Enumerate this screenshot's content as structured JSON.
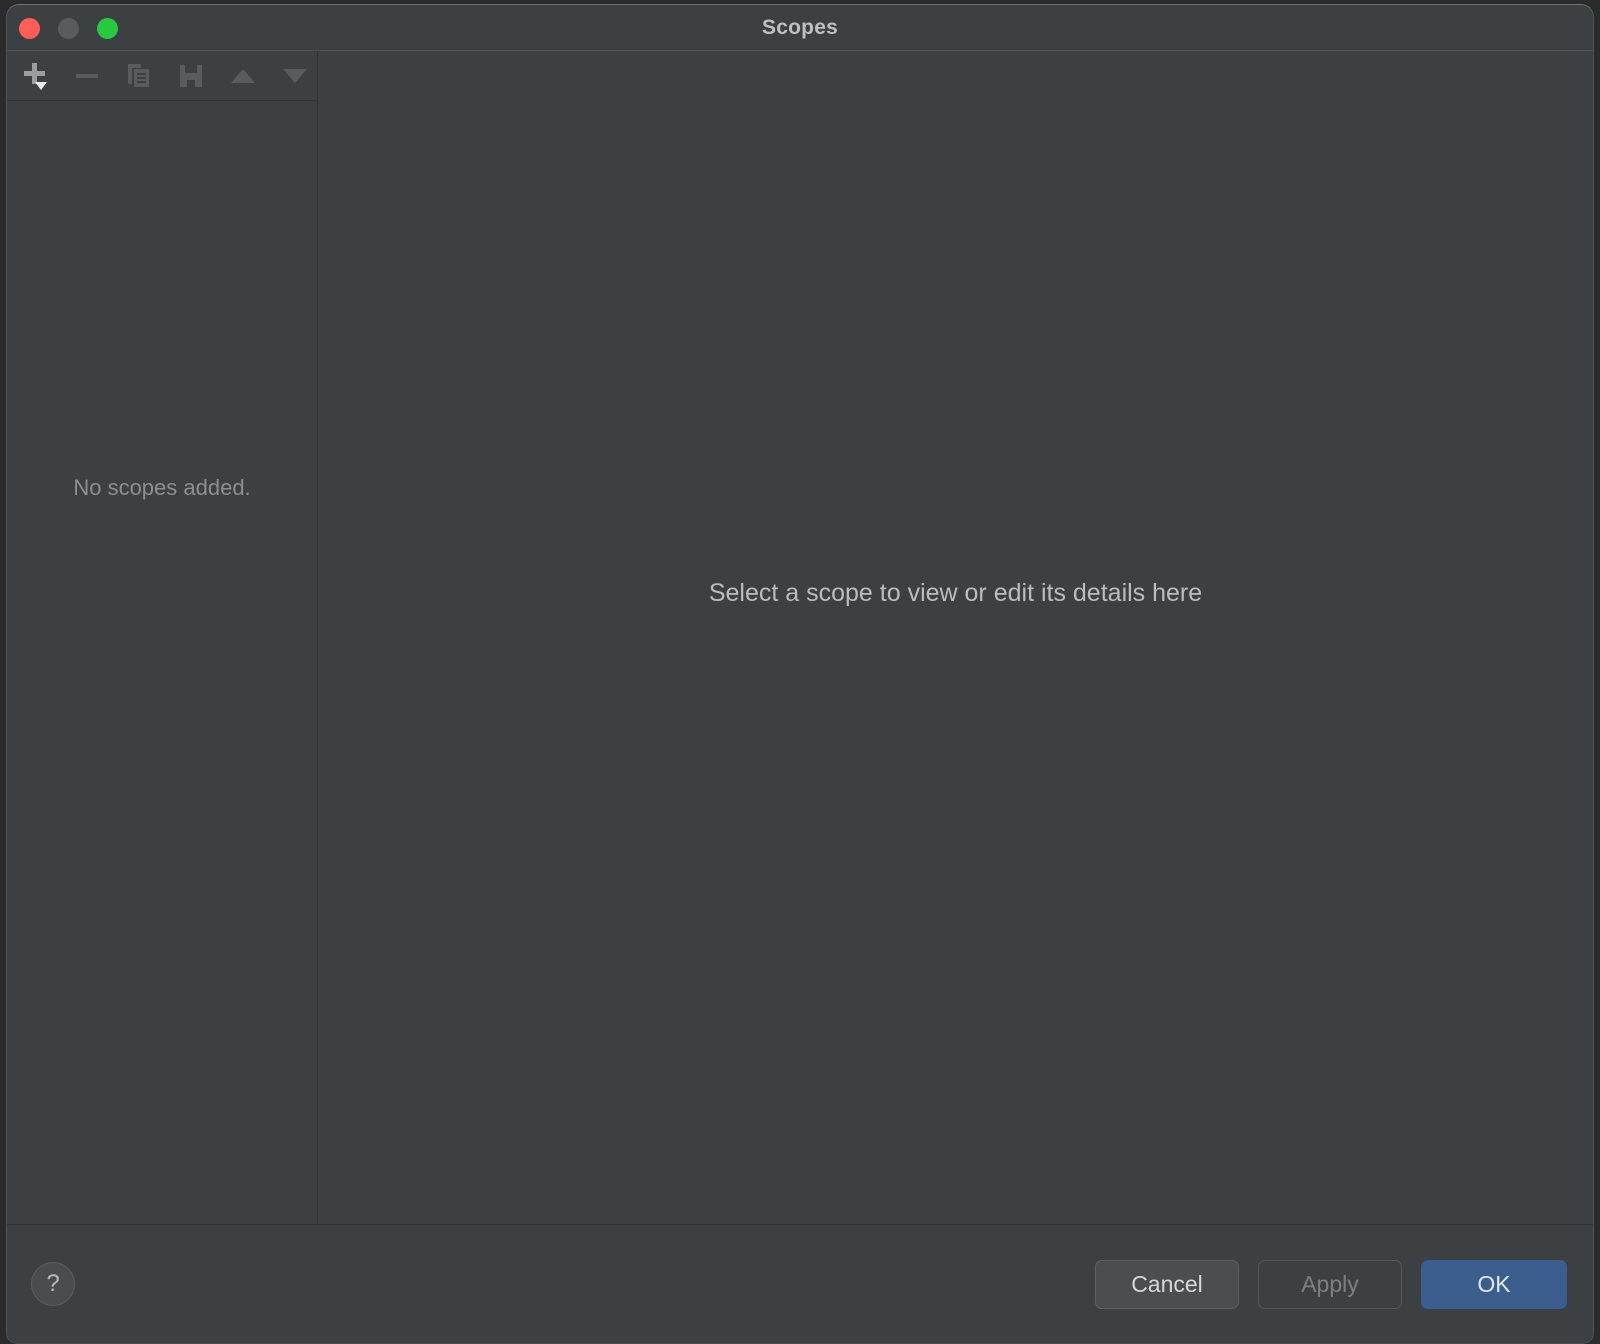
{
  "window": {
    "title": "Scopes",
    "traffic_lights": [
      {
        "name": "close",
        "color": "#ff5f56"
      },
      {
        "name": "minimize",
        "color": "#585c5f"
      },
      {
        "name": "zoom",
        "color": "#28c840"
      }
    ]
  },
  "toolbar": {
    "buttons": [
      {
        "name": "add-scope",
        "icon": "plus-with-dropdown-icon",
        "tooltip": "Add",
        "enabled": true
      },
      {
        "name": "remove-scope",
        "icon": "minus-icon",
        "tooltip": "Remove",
        "enabled": false
      },
      {
        "name": "duplicate-scope",
        "icon": "copy-icon",
        "tooltip": "Duplicate",
        "enabled": false
      },
      {
        "name": "save-scope",
        "icon": "save-icon",
        "tooltip": "Save",
        "enabled": false
      },
      {
        "name": "move-up",
        "icon": "arrow-up-icon",
        "tooltip": "Move Up",
        "enabled": false
      },
      {
        "name": "move-down",
        "icon": "arrow-down-icon",
        "tooltip": "Move Down",
        "enabled": false
      }
    ]
  },
  "sidebar": {
    "empty_message": "No scopes added.",
    "items": []
  },
  "detail": {
    "placeholder": "Select a scope to view or edit its details here"
  },
  "footer": {
    "help_label": "?",
    "buttons": {
      "cancel": "Cancel",
      "apply": "Apply",
      "ok": "OK"
    }
  },
  "colors": {
    "window_background": "#3c4043",
    "title_text": "#bcc0c4",
    "muted_text": "#8b8f92",
    "primary_button": "#3b5e8e",
    "divider": "#313436"
  }
}
